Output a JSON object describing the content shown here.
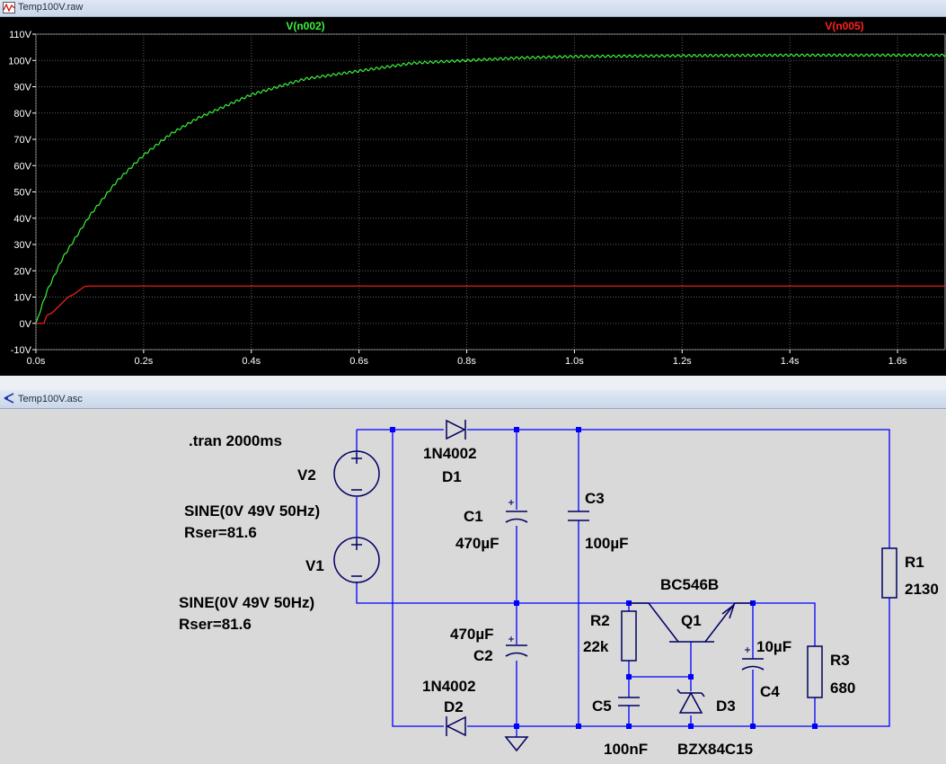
{
  "waveform_window": {
    "title": "Temp100V.raw",
    "icon": "waveform-icon"
  },
  "schematic_window": {
    "title": "Temp100V.asc",
    "icon": "schematic-icon"
  },
  "chart_data": {
    "type": "line",
    "y_tick_labels": [
      "110V",
      "100V",
      "90V",
      "80V",
      "70V",
      "60V",
      "50V",
      "40V",
      "30V",
      "20V",
      "10V",
      "0V",
      "-10V"
    ],
    "x_tick_labels": [
      "0.0s",
      "0.2s",
      "0.4s",
      "0.6s",
      "0.8s",
      "1.0s",
      "1.2s",
      "1.4s",
      "1.6s"
    ],
    "xlim": [
      0,
      1.69
    ],
    "ylim": [
      -10,
      110
    ],
    "grid": true,
    "series": [
      {
        "name": "V(n002)",
        "color": "#3cf03c",
        "x": [
          0,
          0.02,
          0.05,
          0.1,
          0.15,
          0.2,
          0.25,
          0.3,
          0.4,
          0.5,
          0.6,
          0.7,
          0.8,
          0.9,
          1.0,
          1.2,
          1.4,
          1.69
        ],
        "y": [
          0,
          12,
          25,
          41,
          54,
          64,
          72,
          78,
          87,
          93,
          96,
          99,
          100,
          101,
          101.5,
          101.8,
          102,
          102
        ]
      },
      {
        "name": "V(n005)",
        "color": "#ff2020",
        "x": [
          0,
          0.015,
          0.02,
          0.03,
          0.04,
          0.05,
          0.06,
          0.07,
          0.08,
          0.09,
          0.1,
          1.69
        ],
        "y": [
          0,
          0,
          3,
          4,
          6,
          8,
          10,
          11,
          12.5,
          14,
          14.2,
          14.2
        ]
      }
    ]
  },
  "schematic": {
    "directive": ".tran 2000ms",
    "v2_name": "V2",
    "v2_value_1": "SINE(0V 49V 50Hz)",
    "v2_value_2": "Rser=81.6",
    "v1_name": "V1",
    "v1_value_1": "SINE(0V 49V 50Hz)",
    "v1_value_2": "Rser=81.6",
    "d1_model": "1N4002",
    "d1_name": "D1",
    "d2_model": "1N4002",
    "d2_name": "D2",
    "c1_name": "C1",
    "c1_value": "470µF",
    "c2_value": "470µF",
    "c2_name": "C2",
    "c3_name": "C3",
    "c3_value": "100µF",
    "q1_model": "BC546B",
    "q1_name": "Q1",
    "r2_name": "R2",
    "r2_value": "22k",
    "c5_name": "C5",
    "c5_value": "100nF",
    "d3_name": "D3",
    "d3_model": "BZX84C15",
    "c4_value": "10µF",
    "c4_name": "C4",
    "r3_name": "R3",
    "r3_value": "680",
    "r1_name": "R1",
    "r1_value": "2130"
  }
}
